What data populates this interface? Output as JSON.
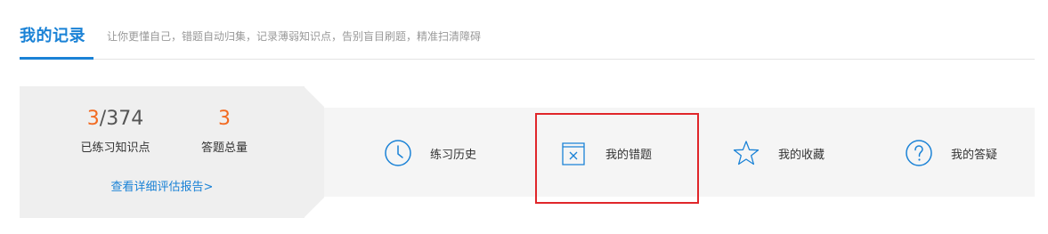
{
  "header": {
    "title": "我的记录",
    "subtitle": "让你更懂自己，错题自动归集，记录薄弱知识点，告别盲目刷题，精准扫清障碍"
  },
  "stats": {
    "practiced": {
      "value_accent": "3",
      "value_rest": "/374",
      "label": "已练习知识点"
    },
    "answered": {
      "value": "3",
      "label": "答题总量"
    },
    "report_link": "查看详细评估报告>"
  },
  "nav": {
    "history": {
      "label": "练习历史",
      "icon": "clock-icon"
    },
    "mistakes": {
      "label": "我的错题",
      "icon": "wrong-answer-icon"
    },
    "favorites": {
      "label": "我的收藏",
      "icon": "star-icon"
    },
    "questions": {
      "label": "我的答疑",
      "icon": "question-icon"
    }
  },
  "colors": {
    "accent_blue": "#1a82d6",
    "accent_orange": "#f26a21",
    "highlight_red": "#e0262a"
  }
}
